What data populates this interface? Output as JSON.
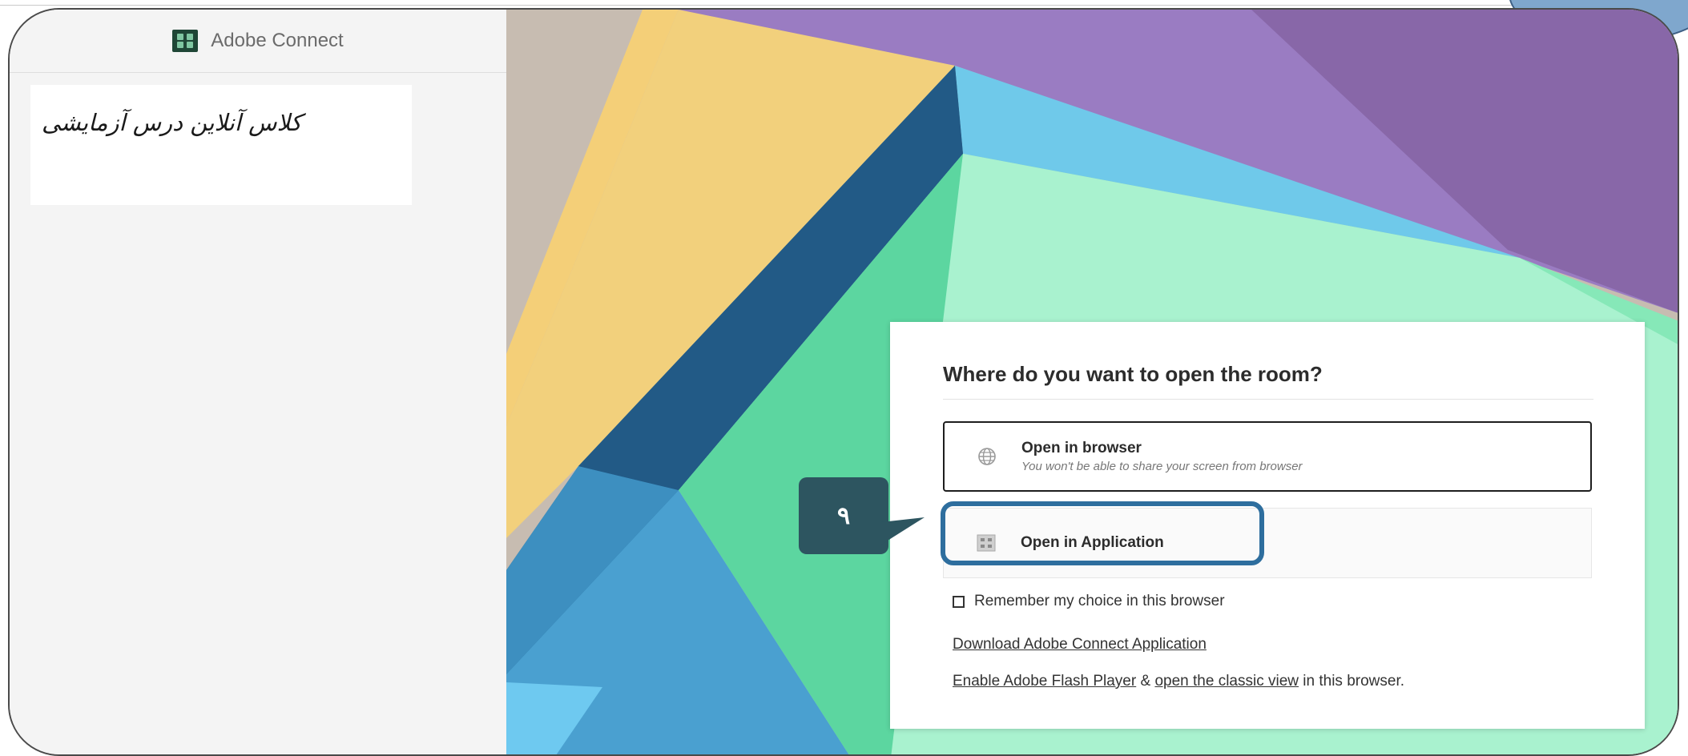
{
  "app": {
    "name": "Adobe Connect",
    "logo_icon": "adobe-connect-logo"
  },
  "sidebar": {
    "course_title": "کلاس آنلاین درس آزمایشی"
  },
  "dialog": {
    "title": "Where do you want to open the room?",
    "options": [
      {
        "label": "Open in browser",
        "subtitle": "You won't be able to share your screen from browser",
        "icon": "globe-icon",
        "selected": true
      },
      {
        "label": "Open in Application",
        "subtitle": "",
        "icon": "app-icon",
        "selected": false
      }
    ],
    "remember_label": "Remember my choice in this browser",
    "remember_checked": false,
    "download_link": "Download Adobe Connect Application",
    "flash_link": "Enable Adobe Flash Player",
    "flash_amp": " & ",
    "classic_link": "open the classic view",
    "flash_suffix": " in this browser."
  },
  "annotation": {
    "step_number": "۹",
    "highlight_color": "#2e6e9e",
    "callout_color": "#2d5560"
  },
  "colors": {
    "panel_bg": "#f4f4f4",
    "text": "#2c2c2c"
  }
}
